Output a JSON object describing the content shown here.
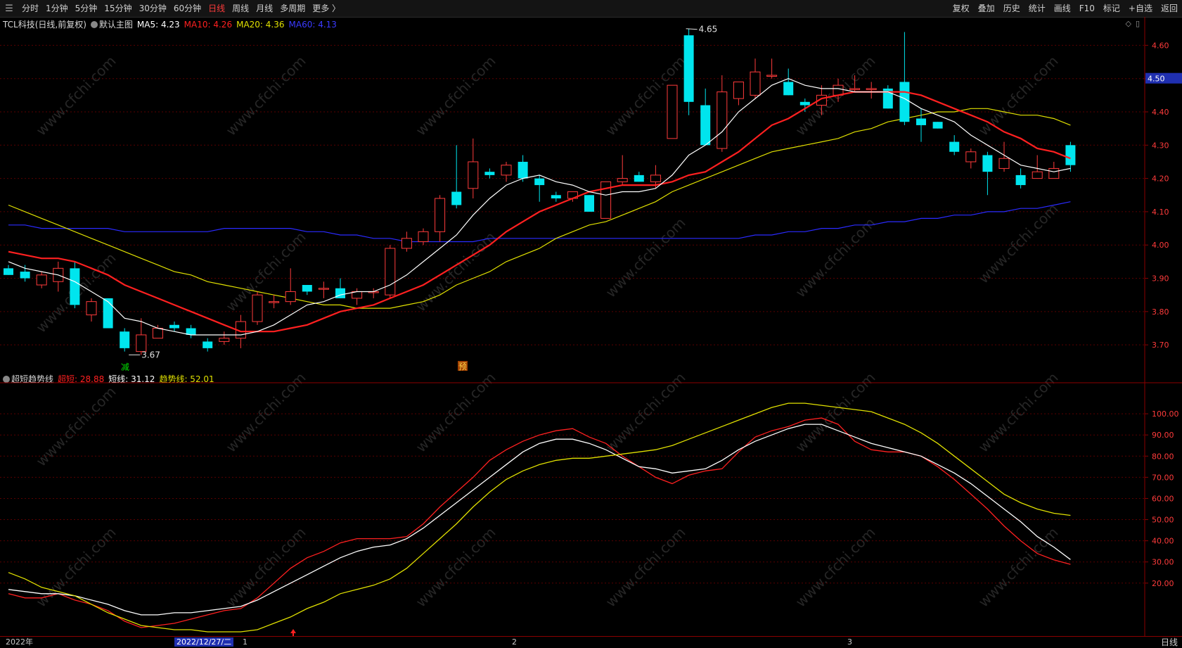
{
  "toolbar": {
    "periods": [
      "分时",
      "1分钟",
      "5分钟",
      "15分钟",
      "30分钟",
      "60分钟",
      "日线",
      "周线",
      "月线",
      "多周期",
      "更多 〉"
    ],
    "active_period": "日线",
    "right_buttons": [
      "复权",
      "叠加",
      "历史",
      "统计",
      "画线",
      "F10",
      "标记",
      "+自选",
      "返回"
    ]
  },
  "main_legend": {
    "stock": "TCL科技(日线,前复权)",
    "template": "默认主图",
    "ma5": "MA5: 4.23",
    "ma10": "MA10: 4.26",
    "ma20": "MA20: 4.36",
    "ma60": "MA60: 4.13"
  },
  "indicator_legend": {
    "name": "超短趋势线",
    "s1": "超短: 28.88",
    "s2": "短线: 31.12",
    "s3": "趋势线: 52.01"
  },
  "annotations": {
    "high": "4.65",
    "low": "3.67",
    "jian": "减",
    "yu": "预",
    "watermark": "www.cfchi.com"
  },
  "price_axis": {
    "ticks": [
      "4.60",
      "4.50",
      "4.40",
      "4.30",
      "4.20",
      "4.10",
      "4.00",
      "3.90",
      "3.80",
      "3.70"
    ],
    "current": "4.50"
  },
  "ind_axis": {
    "ticks": [
      "100.00",
      "90.00",
      "80.00",
      "70.00",
      "60.00",
      "50.00",
      "40.00",
      "30.00",
      "20.00"
    ]
  },
  "x_axis": {
    "year": "2022年",
    "date_cursor": "2022/12/27/二",
    "m1": "1",
    "m2": "2",
    "m3": "3",
    "period_btn": "日线"
  },
  "colors": {
    "up": "#ff3b3b",
    "down": "#00e5ee",
    "ma5": "#ffffff",
    "ma10": "#ff2020",
    "ma20": "#e0e000",
    "ma60": "#2a2aff",
    "grid": "#5a0000"
  },
  "chart_data": {
    "type": "candlestick",
    "price_range": [
      3.62,
      4.66
    ],
    "candles": [
      {
        "o": 3.93,
        "h": 3.94,
        "l": 3.91,
        "c": 3.91
      },
      {
        "o": 3.92,
        "h": 3.94,
        "l": 3.89,
        "c": 3.9
      },
      {
        "o": 3.88,
        "h": 3.92,
        "l": 3.87,
        "c": 3.91
      },
      {
        "o": 3.89,
        "h": 3.95,
        "l": 3.86,
        "c": 3.93
      },
      {
        "o": 3.93,
        "h": 3.95,
        "l": 3.81,
        "c": 3.82
      },
      {
        "o": 3.79,
        "h": 3.84,
        "l": 3.77,
        "c": 3.83
      },
      {
        "o": 3.84,
        "h": 3.84,
        "l": 3.75,
        "c": 3.75
      },
      {
        "o": 3.74,
        "h": 3.75,
        "l": 3.68,
        "c": 3.69
      },
      {
        "o": 3.68,
        "h": 3.78,
        "l": 3.67,
        "c": 3.73
      },
      {
        "o": 3.72,
        "h": 3.76,
        "l": 3.72,
        "c": 3.75
      },
      {
        "o": 3.76,
        "h": 3.77,
        "l": 3.74,
        "c": 3.75
      },
      {
        "o": 3.75,
        "h": 3.76,
        "l": 3.72,
        "c": 3.73
      },
      {
        "o": 3.71,
        "h": 3.72,
        "l": 3.68,
        "c": 3.69
      },
      {
        "o": 3.71,
        "h": 3.74,
        "l": 3.7,
        "c": 3.72
      },
      {
        "o": 3.72,
        "h": 3.79,
        "l": 3.69,
        "c": 3.77
      },
      {
        "o": 3.77,
        "h": 3.86,
        "l": 3.76,
        "c": 3.85
      },
      {
        "o": 3.83,
        "h": 3.85,
        "l": 3.81,
        "c": 3.83
      },
      {
        "o": 3.83,
        "h": 3.93,
        "l": 3.82,
        "c": 3.86
      },
      {
        "o": 3.88,
        "h": 3.88,
        "l": 3.85,
        "c": 3.86
      },
      {
        "o": 3.87,
        "h": 3.89,
        "l": 3.84,
        "c": 3.87
      },
      {
        "o": 3.87,
        "h": 3.9,
        "l": 3.84,
        "c": 3.84
      },
      {
        "o": 3.84,
        "h": 3.87,
        "l": 3.82,
        "c": 3.86
      },
      {
        "o": 3.86,
        "h": 3.87,
        "l": 3.84,
        "c": 3.86
      },
      {
        "o": 3.85,
        "h": 4.0,
        "l": 3.84,
        "c": 3.99
      },
      {
        "o": 3.99,
        "h": 4.04,
        "l": 3.98,
        "c": 4.02
      },
      {
        "o": 4.01,
        "h": 4.05,
        "l": 4.0,
        "c": 4.04
      },
      {
        "o": 4.04,
        "h": 4.15,
        "l": 4.01,
        "c": 4.14
      },
      {
        "o": 4.16,
        "h": 4.3,
        "l": 4.11,
        "c": 4.12
      },
      {
        "o": 4.17,
        "h": 4.32,
        "l": 4.14,
        "c": 4.25
      },
      {
        "o": 4.22,
        "h": 4.23,
        "l": 4.2,
        "c": 4.21
      },
      {
        "o": 4.21,
        "h": 4.25,
        "l": 4.19,
        "c": 4.24
      },
      {
        "o": 4.25,
        "h": 4.27,
        "l": 4.19,
        "c": 4.2
      },
      {
        "o": 4.2,
        "h": 4.21,
        "l": 4.13,
        "c": 4.18
      },
      {
        "o": 4.15,
        "h": 4.16,
        "l": 4.13,
        "c": 4.14
      },
      {
        "o": 4.14,
        "h": 4.16,
        "l": 4.13,
        "c": 4.16
      },
      {
        "o": 4.15,
        "h": 4.15,
        "l": 4.1,
        "c": 4.1
      },
      {
        "o": 4.08,
        "h": 4.19,
        "l": 4.08,
        "c": 4.19
      },
      {
        "o": 4.19,
        "h": 4.27,
        "l": 4.18,
        "c": 4.2
      },
      {
        "o": 4.21,
        "h": 4.22,
        "l": 4.19,
        "c": 4.19
      },
      {
        "o": 4.19,
        "h": 4.24,
        "l": 4.17,
        "c": 4.21
      },
      {
        "o": 4.32,
        "h": 4.48,
        "l": 4.32,
        "c": 4.48
      },
      {
        "o": 4.63,
        "h": 4.65,
        "l": 4.39,
        "c": 4.43
      },
      {
        "o": 4.42,
        "h": 4.47,
        "l": 4.3,
        "c": 4.3
      },
      {
        "o": 4.29,
        "h": 4.51,
        "l": 4.28,
        "c": 4.46
      },
      {
        "o": 4.44,
        "h": 4.49,
        "l": 4.42,
        "c": 4.49
      },
      {
        "o": 4.45,
        "h": 4.56,
        "l": 4.44,
        "c": 4.52
      },
      {
        "o": 4.51,
        "h": 4.56,
        "l": 4.5,
        "c": 4.51
      },
      {
        "o": 4.49,
        "h": 4.53,
        "l": 4.45,
        "c": 4.45
      },
      {
        "o": 4.43,
        "h": 4.44,
        "l": 4.4,
        "c": 4.42
      },
      {
        "o": 4.42,
        "h": 4.48,
        "l": 4.39,
        "c": 4.45
      },
      {
        "o": 4.45,
        "h": 4.5,
        "l": 4.43,
        "c": 4.48
      },
      {
        "o": 4.47,
        "h": 4.51,
        "l": 4.46,
        "c": 4.47
      },
      {
        "o": 4.47,
        "h": 4.49,
        "l": 4.44,
        "c": 4.47
      },
      {
        "o": 4.47,
        "h": 4.48,
        "l": 4.41,
        "c": 4.41
      },
      {
        "o": 4.49,
        "h": 4.64,
        "l": 4.36,
        "c": 4.37
      },
      {
        "o": 4.38,
        "h": 4.41,
        "l": 4.31,
        "c": 4.36
      },
      {
        "o": 4.37,
        "h": 4.37,
        "l": 4.35,
        "c": 4.35
      },
      {
        "o": 4.31,
        "h": 4.33,
        "l": 4.27,
        "c": 4.28
      },
      {
        "o": 4.25,
        "h": 4.29,
        "l": 4.23,
        "c": 4.28
      },
      {
        "o": 4.27,
        "h": 4.28,
        "l": 4.15,
        "c": 4.22
      },
      {
        "o": 4.23,
        "h": 4.31,
        "l": 4.22,
        "c": 4.26
      },
      {
        "o": 4.21,
        "h": 4.23,
        "l": 4.17,
        "c": 4.18
      },
      {
        "o": 4.2,
        "h": 4.27,
        "l": 4.2,
        "c": 4.22
      },
      {
        "o": 4.2,
        "h": 4.25,
        "l": 4.2,
        "c": 4.23
      },
      {
        "o": 4.3,
        "h": 4.31,
        "l": 4.22,
        "c": 4.24
      }
    ],
    "ma5": [
      3.95,
      3.93,
      3.92,
      3.91,
      3.89,
      3.86,
      3.83,
      3.78,
      3.77,
      3.75,
      3.74,
      3.73,
      3.73,
      3.73,
      3.73,
      3.74,
      3.76,
      3.79,
      3.82,
      3.83,
      3.85,
      3.86,
      3.86,
      3.88,
      3.91,
      3.95,
      3.99,
      4.03,
      4.09,
      4.14,
      4.18,
      4.2,
      4.21,
      4.19,
      4.18,
      4.16,
      4.15,
      4.16,
      4.16,
      4.17,
      4.21,
      4.27,
      4.3,
      4.34,
      4.4,
      4.44,
      4.48,
      4.5,
      4.48,
      4.47,
      4.47,
      4.46,
      4.46,
      4.46,
      4.44,
      4.41,
      4.39,
      4.37,
      4.33,
      4.3,
      4.27,
      4.24,
      4.23,
      4.22,
      4.23
    ],
    "ma10": [
      3.98,
      3.97,
      3.96,
      3.96,
      3.95,
      3.93,
      3.91,
      3.88,
      3.86,
      3.84,
      3.82,
      3.8,
      3.78,
      3.76,
      3.74,
      3.74,
      3.74,
      3.75,
      3.76,
      3.78,
      3.8,
      3.81,
      3.82,
      3.84,
      3.86,
      3.88,
      3.91,
      3.94,
      3.97,
      4.0,
      4.04,
      4.07,
      4.1,
      4.12,
      4.14,
      4.16,
      4.17,
      4.18,
      4.18,
      4.18,
      4.19,
      4.21,
      4.22,
      4.25,
      4.28,
      4.32,
      4.36,
      4.38,
      4.41,
      4.44,
      4.45,
      4.46,
      4.46,
      4.46,
      4.46,
      4.45,
      4.43,
      4.41,
      4.39,
      4.37,
      4.34,
      4.32,
      4.29,
      4.28,
      4.26
    ],
    "ma20": [
      4.12,
      4.1,
      4.08,
      4.06,
      4.04,
      4.02,
      4.0,
      3.98,
      3.96,
      3.94,
      3.92,
      3.91,
      3.89,
      3.88,
      3.87,
      3.86,
      3.85,
      3.84,
      3.83,
      3.82,
      3.82,
      3.81,
      3.81,
      3.81,
      3.82,
      3.83,
      3.85,
      3.88,
      3.9,
      3.92,
      3.95,
      3.97,
      3.99,
      4.02,
      4.04,
      4.06,
      4.07,
      4.09,
      4.11,
      4.13,
      4.16,
      4.18,
      4.2,
      4.22,
      4.24,
      4.26,
      4.28,
      4.29,
      4.3,
      4.31,
      4.32,
      4.34,
      4.35,
      4.37,
      4.38,
      4.39,
      4.4,
      4.4,
      4.41,
      4.41,
      4.4,
      4.39,
      4.39,
      4.38,
      4.36
    ],
    "ma60": [
      4.06,
      4.06,
      4.05,
      4.05,
      4.05,
      4.05,
      4.05,
      4.04,
      4.04,
      4.04,
      4.04,
      4.04,
      4.04,
      4.05,
      4.05,
      4.05,
      4.05,
      4.05,
      4.04,
      4.04,
      4.03,
      4.03,
      4.02,
      4.02,
      4.01,
      4.01,
      4.01,
      4.01,
      4.01,
      4.02,
      4.02,
      4.02,
      4.02,
      4.02,
      4.02,
      4.02,
      4.02,
      4.02,
      4.02,
      4.02,
      4.02,
      4.02,
      4.02,
      4.02,
      4.02,
      4.03,
      4.03,
      4.04,
      4.04,
      4.05,
      4.05,
      4.06,
      4.06,
      4.07,
      4.07,
      4.08,
      4.08,
      4.09,
      4.09,
      4.1,
      4.1,
      4.11,
      4.11,
      4.12,
      4.13
    ],
    "indicator": {
      "range": [
        -5,
        112
      ],
      "series": [
        {
          "name": "超短",
          "color": "#ff2020",
          "values": [
            15,
            13,
            13,
            15,
            12,
            10,
            7,
            2,
            -1,
            0,
            1,
            3,
            5,
            7,
            8,
            13,
            20,
            27,
            32,
            35,
            39,
            41,
            41,
            41,
            42,
            48,
            56,
            63,
            70,
            78,
            83,
            87,
            90,
            92,
            93,
            89,
            86,
            80,
            75,
            70,
            67,
            71,
            73,
            74,
            82,
            89,
            92,
            94,
            97,
            98,
            95,
            87,
            83,
            82,
            82,
            80,
            75,
            69,
            62,
            55,
            47,
            40,
            34,
            31,
            28.88
          ]
        },
        {
          "name": "短线",
          "color": "#ffffff",
          "values": [
            17,
            16,
            15,
            15,
            14,
            12,
            10,
            7,
            5,
            5,
            6,
            6,
            7,
            8,
            9,
            12,
            16,
            20,
            24,
            28,
            32,
            35,
            37,
            38,
            41,
            46,
            52,
            58,
            64,
            70,
            76,
            82,
            86,
            88,
            88,
            86,
            83,
            79,
            75,
            74,
            72,
            73,
            74,
            78,
            83,
            87,
            90,
            93,
            95,
            95,
            92,
            89,
            86,
            84,
            82,
            80,
            76,
            72,
            67,
            61,
            55,
            49,
            42,
            37,
            31.12
          ]
        },
        {
          "name": "趋势线",
          "color": "#e0e000",
          "values": [
            25,
            22,
            18,
            16,
            14,
            10,
            6,
            3,
            0,
            -1,
            -2,
            -2,
            -3,
            -3,
            -3,
            -2,
            1,
            4,
            8,
            11,
            15,
            17,
            19,
            22,
            27,
            34,
            41,
            48,
            56,
            63,
            69,
            73,
            76,
            78,
            79,
            79,
            80,
            81,
            82,
            83,
            85,
            88,
            91,
            94,
            97,
            100,
            103,
            105,
            105,
            104,
            103,
            102,
            101,
            98,
            95,
            91,
            86,
            80,
            74,
            68,
            62,
            58,
            55,
            53,
            52.01
          ]
        }
      ]
    }
  }
}
